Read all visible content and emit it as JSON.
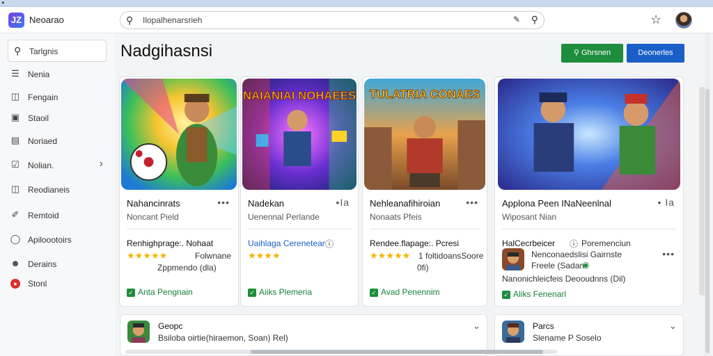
{
  "app": {
    "title": "Neoarao",
    "logo": "JZ"
  },
  "search": {
    "value": "Ilopalhenarsrieh"
  },
  "sidebar": {
    "search_label": "Tarlgnis",
    "items": [
      {
        "label": "Nenia",
        "icon": "layers-icon"
      },
      {
        "label": "Fengain",
        "icon": "bookmark-icon"
      },
      {
        "label": "Staoil",
        "icon": "square-icon"
      },
      {
        "label": "Noriaed",
        "icon": "document-icon"
      },
      {
        "label": "Nolian.",
        "icon": "checkbox-icon",
        "chevron": "›"
      },
      {
        "label": "Reodianeis",
        "icon": "grid-icon"
      },
      {
        "label": "Remtoid",
        "icon": "brush-icon"
      },
      {
        "label": "Apiloootoirs",
        "icon": "chat-icon"
      },
      {
        "label": "Derains",
        "icon": "person-icon"
      },
      {
        "label": "Stonl",
        "icon": "red-circle-icon"
      }
    ]
  },
  "main": {
    "page_title": "Nadgihasnsi",
    "btn_green": "Ghrsnen",
    "btn_blue": "Deonerles"
  },
  "cards": [
    {
      "art_title": "",
      "title": "Nahancinrats",
      "more": "•••",
      "subtitle": "Noncant Pield",
      "line2": "Renhighprage:. Nohaat",
      "stars": "★★★★★",
      "note1": "Folwnane",
      "note2": "Zppmendo (dla)",
      "badge": "Anta Pengnain"
    },
    {
      "art_title": "NAIANIAI NOHAEES",
      "title": "Nadekan",
      "more": "•Ia",
      "subtitle": "Uenennal Perlande",
      "line2": "Uaihlaga Cerenetear",
      "stars": "★★★★",
      "note1": "",
      "note2": "",
      "badge": "Aiiks Plemeria"
    },
    {
      "art_title": "TULATRIA CONAES",
      "title": "Nehleanafihiroian",
      "more": "•••",
      "subtitle": "Nonaats Pfeis",
      "line2": "Rendee.flapage:. Pcresi",
      "stars": "★★★★★",
      "note1": "1 foltidoansSoore",
      "note2": "0fi)",
      "badge": "Avad Penennim"
    },
    {
      "art_title": "",
      "title": "Applona Peen INaNeenlnal",
      "more": "• Ia",
      "subtitle": "Wiposant Nian",
      "line2": "HalCecrbeicer",
      "line2b": "Poremenciun",
      "row1a": "Nenconaedslisi Gairnste",
      "row1b": "Freele (Sadan",
      "row2": "Nanonichleicfeis Deooudnns (Dil)",
      "badge": "Aliks Fenenarl"
    }
  ],
  "bottom_cards": [
    {
      "title": "Geopc",
      "subtitle": "Bsiloba oirtie(hiraemon, Soan) Rel)"
    },
    {
      "title": "Parcs",
      "subtitle": "Slename P Soselo"
    }
  ],
  "colors": {
    "green": "#1e8e3e",
    "blue": "#1a5fc8",
    "star": "#f4b400"
  }
}
